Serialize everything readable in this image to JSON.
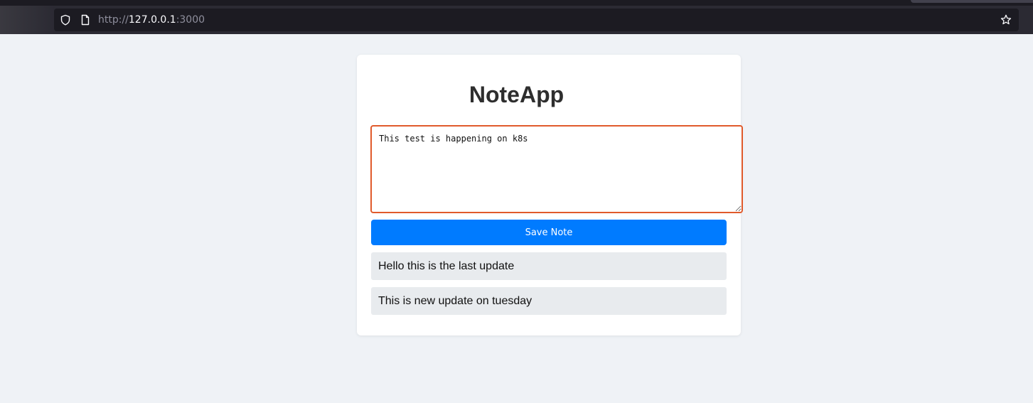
{
  "browser": {
    "url_scheme": "http://",
    "url_host": "127.0.0.1",
    "url_port": ":3000",
    "icons": [
      "shield-icon",
      "page-icon",
      "star-icon"
    ]
  },
  "app": {
    "title": "NoteApp",
    "note_input_value": "This test is happening on k8s",
    "save_label": "Save Note",
    "notes": [
      "Hello this is the last update",
      "This is new update on tuesday"
    ]
  },
  "colors": {
    "accent": "#007bff",
    "focus_border": "#e05a2b",
    "background": "#eff2f6",
    "note_bg": "#e8ebee"
  }
}
